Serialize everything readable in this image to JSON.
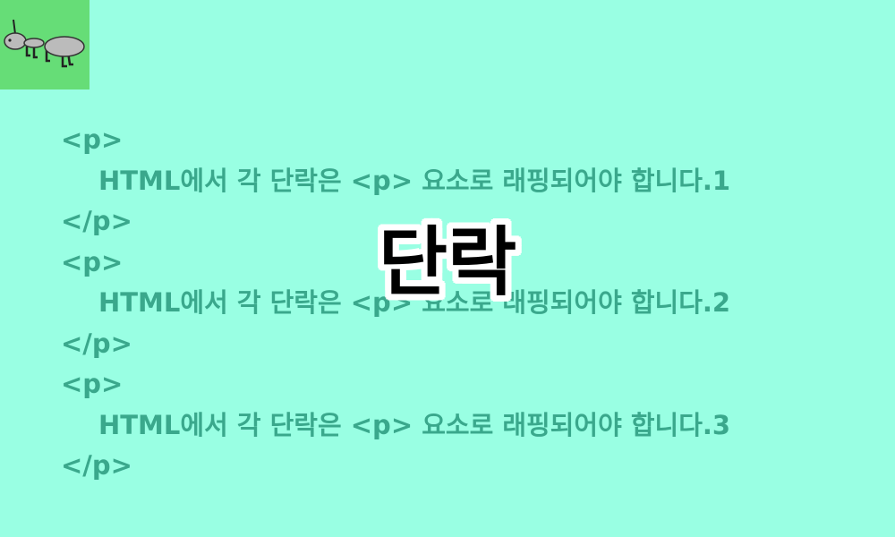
{
  "logo": {
    "icon": "ant-icon",
    "background": "#66dd77"
  },
  "background": "#99ffe3",
  "text_color": "#3aa88c",
  "code_lines": [
    {
      "text": "<p>",
      "indent": false
    },
    {
      "text": "HTML에서 각 단락은 <p> 요소로 래핑되어야 합니다.1",
      "indent": true
    },
    {
      "text": "</p>",
      "indent": false
    },
    {
      "text": "<p>",
      "indent": false
    },
    {
      "text": "HTML에서 각 단락은 <p> 요소로 래핑되어야 합니다.2",
      "indent": true
    },
    {
      "text": "</p>",
      "indent": false
    },
    {
      "text": "<p>",
      "indent": false
    },
    {
      "text": "HTML에서 각 단락은 <p> 요소로 래핑되어야 합니다.3",
      "indent": true
    },
    {
      "text": "</p>",
      "indent": false
    }
  ],
  "title": "단락"
}
